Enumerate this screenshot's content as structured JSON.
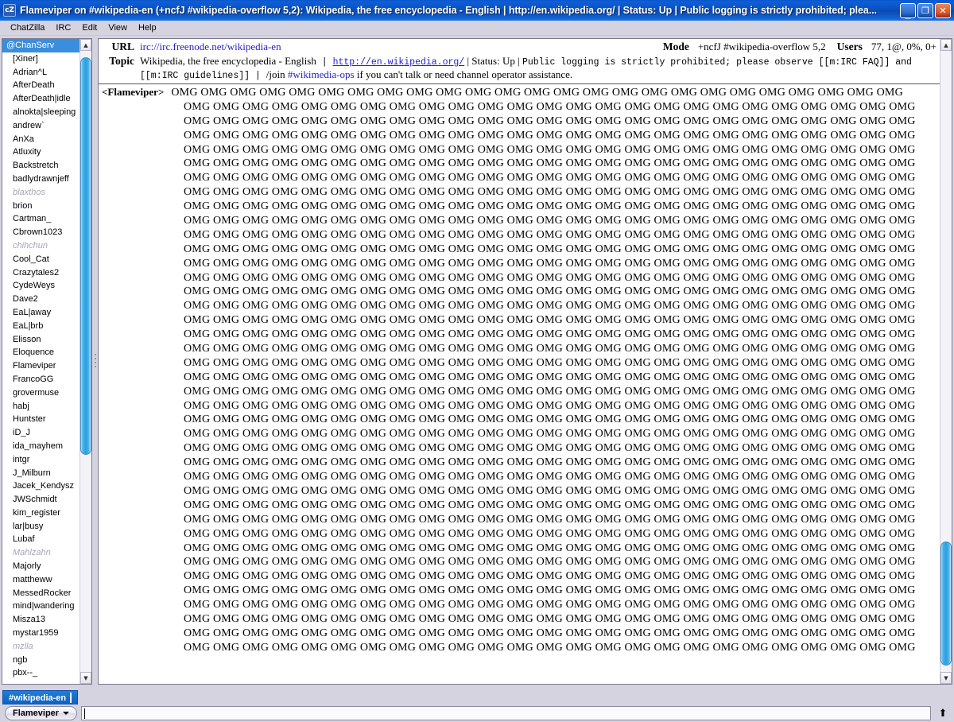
{
  "window": {
    "title": "Flameviper on #wikipedia-en (+ncfJ #wikipedia-overflow 5,2): Wikipedia, the free encyclopedia - English | http://en.wikipedia.org/ | Status: Up | Public logging is strictly prohibited; plea...",
    "icon_label": "cZ",
    "minimize_label": "_",
    "maximize_label": "❐",
    "close_label": "✕"
  },
  "menubar": {
    "items": [
      {
        "label": "ChatZilla"
      },
      {
        "label": "IRC"
      },
      {
        "label": "Edit"
      },
      {
        "label": "View"
      },
      {
        "label": "Help"
      }
    ]
  },
  "header": {
    "url_label": "URL",
    "url_value": "irc://irc.freenode.net/wikipedia-en",
    "mode_label": "Mode",
    "mode_value": "+ncfJ #wikipedia-overflow 5,2",
    "users_label": "Users",
    "users_value": "77, 1@, 0%, 0+",
    "topic_label": "Topic",
    "topic_part1": "Wikipedia, the free encyclopedia - English",
    "topic_sep1": " | ",
    "topic_link1": "http://en.wikipedia.org/",
    "topic_part2": " | Status: Up | ",
    "topic_mono1": "Public logging is strictly prohibited; please observe [[m:IRC FAQ]] and [[m:IRC guidelines]]",
    "topic_sep2": " | ",
    "topic_part3": "/join ",
    "topic_link2": "#wikimedia-ops",
    "topic_part4": " if you can't talk or need channel operator assistance."
  },
  "chat": {
    "nick": "<Flameviper>",
    "message_token": "OMG",
    "tokens_per_line": 25,
    "line_count": 40
  },
  "userlist": {
    "items": [
      {
        "name": "@ChanServ",
        "state": "selected"
      },
      {
        "name": "[Xiner]",
        "state": "normal"
      },
      {
        "name": "Adrian^L",
        "state": "normal"
      },
      {
        "name": "AfterDeath",
        "state": "normal"
      },
      {
        "name": "AfterDeath|idle",
        "state": "normal"
      },
      {
        "name": "alnokta|sleeping",
        "state": "normal"
      },
      {
        "name": "andrew`",
        "state": "normal"
      },
      {
        "name": "AnXa",
        "state": "normal"
      },
      {
        "name": "Atluxity",
        "state": "normal"
      },
      {
        "name": "Backstretch",
        "state": "normal"
      },
      {
        "name": "badlydrawnjeff",
        "state": "normal"
      },
      {
        "name": "blaxthos",
        "state": "away"
      },
      {
        "name": "brion",
        "state": "normal"
      },
      {
        "name": "Cartman_",
        "state": "normal"
      },
      {
        "name": "Cbrown1023",
        "state": "normal"
      },
      {
        "name": "chihchun",
        "state": "away"
      },
      {
        "name": "Cool_Cat",
        "state": "normal"
      },
      {
        "name": "Crazytales2",
        "state": "normal"
      },
      {
        "name": "CydeWeys",
        "state": "normal"
      },
      {
        "name": "Dave2",
        "state": "normal"
      },
      {
        "name": "EaL|away",
        "state": "normal"
      },
      {
        "name": "EaL|brb",
        "state": "normal"
      },
      {
        "name": "Elisson",
        "state": "normal"
      },
      {
        "name": "Eloquence",
        "state": "normal"
      },
      {
        "name": "Flameviper",
        "state": "normal"
      },
      {
        "name": "FrancoGG",
        "state": "normal"
      },
      {
        "name": "grovermuse",
        "state": "normal"
      },
      {
        "name": "habj",
        "state": "normal"
      },
      {
        "name": "Huntster",
        "state": "normal"
      },
      {
        "name": "iD_J",
        "state": "normal"
      },
      {
        "name": "ida_mayhem",
        "state": "normal"
      },
      {
        "name": "intgr",
        "state": "normal"
      },
      {
        "name": "J_Milburn",
        "state": "normal"
      },
      {
        "name": "Jacek_Kendysz",
        "state": "normal"
      },
      {
        "name": "JWSchmidt",
        "state": "normal"
      },
      {
        "name": "kim_register",
        "state": "normal"
      },
      {
        "name": "lar|busy",
        "state": "normal"
      },
      {
        "name": "Lubaf",
        "state": "normal"
      },
      {
        "name": "Mahlzahn",
        "state": "away"
      },
      {
        "name": "Majorly",
        "state": "normal"
      },
      {
        "name": "mattheww",
        "state": "normal"
      },
      {
        "name": "MessedRocker",
        "state": "normal"
      },
      {
        "name": "mind|wandering",
        "state": "normal"
      },
      {
        "name": "Misza13",
        "state": "normal"
      },
      {
        "name": "mystar1959",
        "state": "normal"
      },
      {
        "name": "mzlla",
        "state": "away"
      },
      {
        "name": "ngb",
        "state": "normal"
      },
      {
        "name": "pbx--_",
        "state": "normal"
      }
    ]
  },
  "tabs": [
    {
      "label": "#wikipedia-en",
      "active": true
    }
  ],
  "input": {
    "nick_button_label": "Flameviper",
    "value": "",
    "placeholder": "",
    "scroll_bottom_icon": "⬆"
  },
  "scrollbars": {
    "userlist": {
      "up_arrow": "▲",
      "down_arrow": "▼",
      "thumb_top_pct": 1,
      "thumb_height_pct": 64
    },
    "chat": {
      "up_arrow": "▲",
      "down_arrow": "▼",
      "thumb_top_pct": 79,
      "thumb_height_pct": 20
    }
  },
  "colors": {
    "titlebar": "#0b51c0",
    "selection": "#3a8ede",
    "link": "#2222cc",
    "away_text": "#a8a5b5",
    "chrome": "#d6d3e0",
    "tab_active": "#0d5fc0"
  }
}
